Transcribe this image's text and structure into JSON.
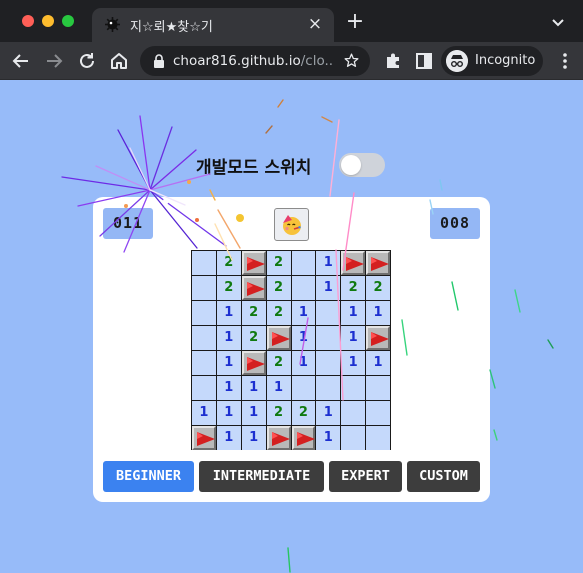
{
  "browser": {
    "tab_title": "지☆뢰★찾☆기",
    "tab_close": "×",
    "new_tab": "+",
    "url_host": "choar816.github.io",
    "url_path": "/clo...",
    "incognito_label": "Incognito"
  },
  "page": {
    "dev_mode_label": "개발모드 스위치",
    "dev_mode_on": false
  },
  "game": {
    "mine_counter": "011",
    "timer": "008",
    "face_icon": "party-face-icon",
    "board": [
      [
        "",
        "2",
        "F",
        "2",
        "",
        "1",
        "F",
        "F"
      ],
      [
        "",
        "2",
        "F",
        "2",
        "",
        "1",
        "2",
        "2"
      ],
      [
        "",
        "1",
        "2",
        "2",
        "1",
        "",
        "1",
        "1"
      ],
      [
        "",
        "1",
        "2",
        "F",
        "1",
        "",
        "1",
        "F"
      ],
      [
        "",
        "1",
        "F",
        "2",
        "1",
        "",
        "1",
        "1"
      ],
      [
        "",
        "1",
        "1",
        "1",
        "",
        "",
        "",
        ""
      ],
      [
        "1",
        "1",
        "1",
        "2",
        "2",
        "1",
        "",
        ""
      ],
      [
        "F",
        "1",
        "1",
        "F",
        "F",
        "1",
        "",
        ""
      ]
    ],
    "levels": [
      {
        "label": "BEGINNER",
        "active": true
      },
      {
        "label": "INTERMEDIATE",
        "active": false
      },
      {
        "label": "EXPERT",
        "active": false
      },
      {
        "label": "CUSTOM",
        "active": false
      }
    ]
  },
  "colors": {
    "page_bg": "#97bbf9",
    "active_level": "#3b82f0",
    "level_bg": "#3d3d3d",
    "counter_bg": "#94b7f5",
    "flag": "#d42020",
    "number_1": "#1c2fd0",
    "number_2": "#107a10"
  }
}
